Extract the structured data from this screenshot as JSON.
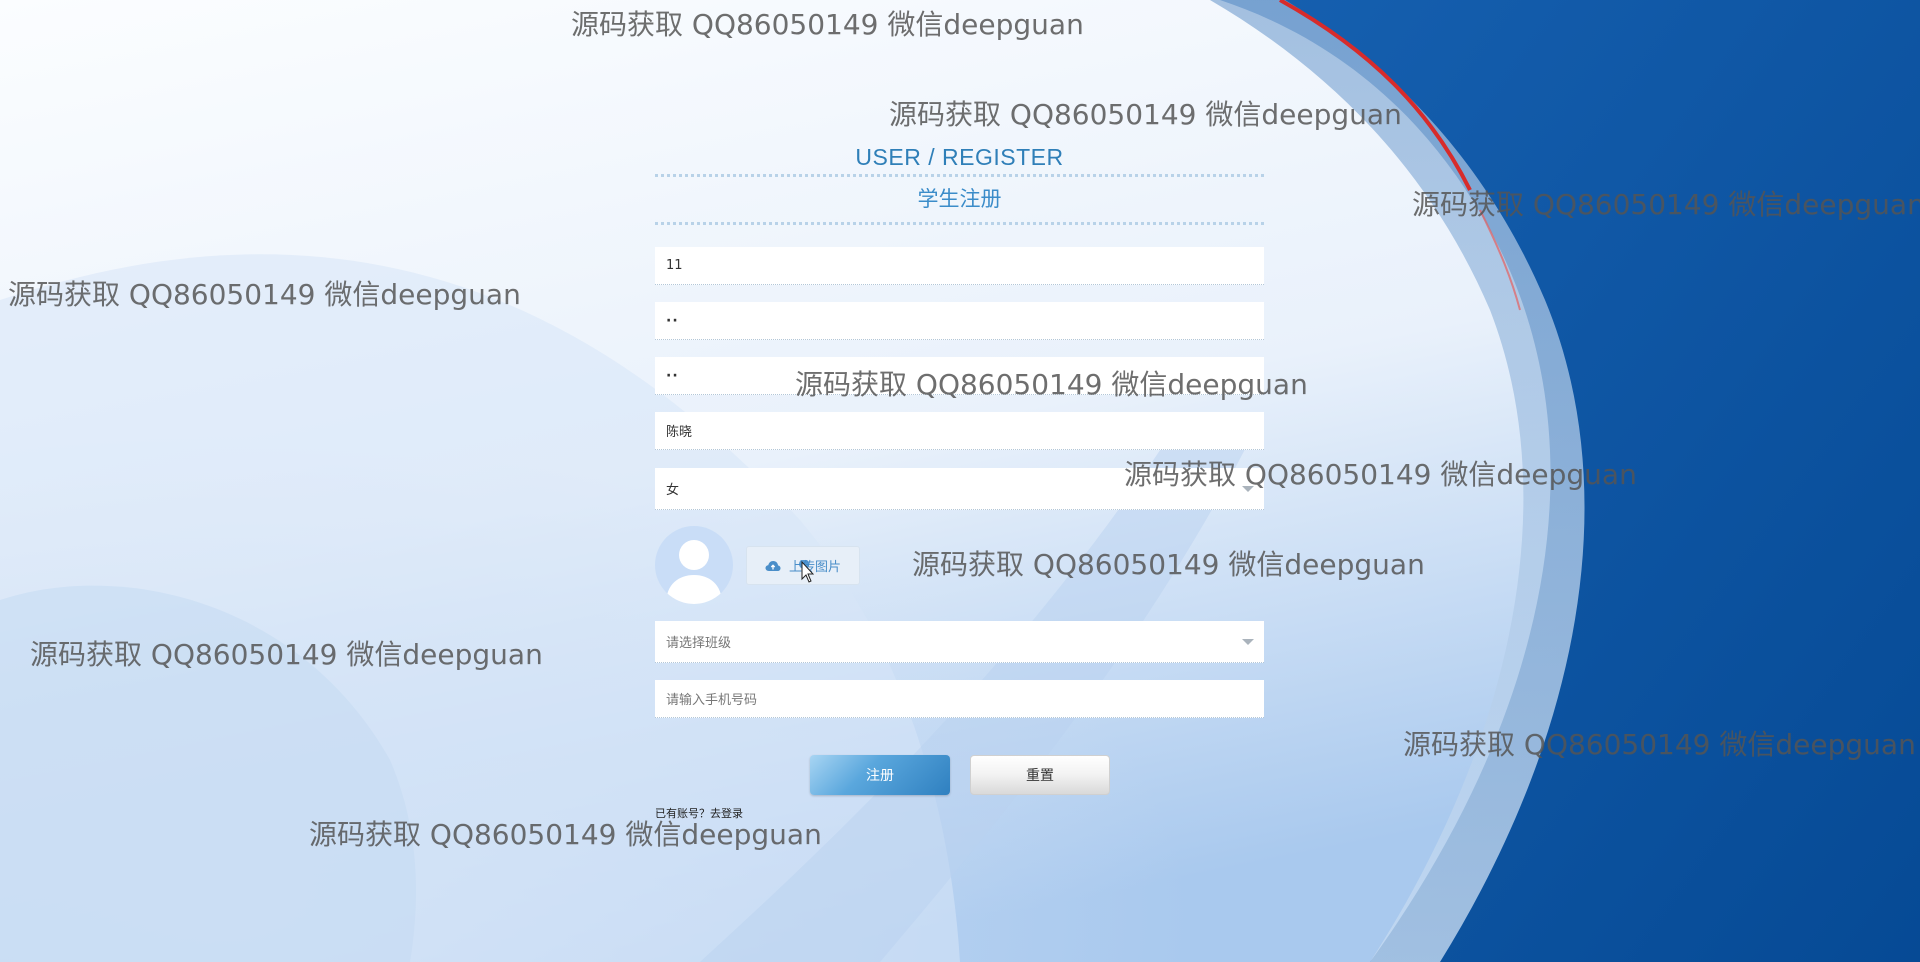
{
  "form": {
    "title_en": "USER / REGISTER",
    "title_cn": "学生注册",
    "fields": [
      {
        "value": "11",
        "placeholder": ""
      },
      {
        "value": "··",
        "placeholder": ""
      },
      {
        "value": "··",
        "placeholder": ""
      },
      {
        "value": "陈晓",
        "placeholder": ""
      },
      {
        "value": "女",
        "placeholder": ""
      },
      {
        "value": "请选择班级",
        "placeholder": "请选择班级"
      },
      {
        "value": "请输入手机号码",
        "placeholder": "请输入手机号码"
      }
    ],
    "upload_label": "上传图片",
    "register_label": "注册",
    "reset_label": "重置",
    "login_link": "已有账号？去登录"
  },
  "watermark_text": "源码获取 QQ86050149 微信deepguan",
  "colors": {
    "accent_blue": "#2f7fb8",
    "deep_blue": "#0d55a4",
    "red_stroke": "#d72b2b"
  }
}
